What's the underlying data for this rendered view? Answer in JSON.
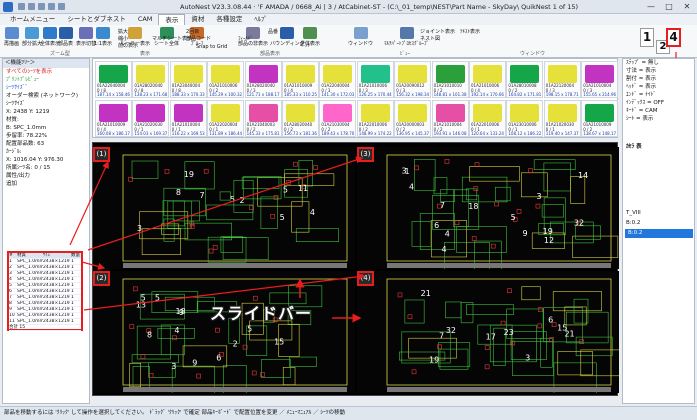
{
  "window": {
    "title": "AutoNest V23.3.08.44 · 'F AMADA / 0668_Ai | 3 / AtCabinet-ST - (C:\\_01_temp\\NEST\\Part Name - SkyDay\\ QuikNest 1 of 15)",
    "buttons": [
      "—",
      "□",
      "✕"
    ]
  },
  "menu": [
    "ホームメニュー",
    "シートとダブネスト",
    "CAM",
    "表示",
    "資材",
    "各種設定",
    "ﾍﾙﾌﾟ"
  ],
  "menu_active": 3,
  "ribbon": {
    "buttons": [
      {
        "label": "再描画",
        "icon": "redraw-icon"
      },
      {
        "label": "部分拡大",
        "icon": "zoom-icon"
      },
      {
        "label": "全体表示",
        "icon": "fit-icon"
      },
      {
        "label": "部品表",
        "icon": "parts-icon"
      },
      {
        "label": "表示切替",
        "icon": "switch-icon"
      },
      {
        "label": "1:1表示",
        "icon": "scale-icon"
      },
      {
        "label": "ルーラー表示",
        "icon": "ruler-icon"
      },
      {
        "label": "シート全体",
        "icon": "sheet-icon"
      },
      {
        "label": "ﾌﾟﾙｰﾌ",
        "icon": "proof-icon"
      },
      {
        "label": "部品の非表示",
        "icon": "hide-icon"
      },
      {
        "label": "バウンディング",
        "icon": "bbox-icon"
      },
      {
        "label": "全体表示",
        "icon": "all-icon"
      },
      {
        "label": "ウィンドウ",
        "icon": "window-icon"
      },
      {
        "label": "ﾏﾙﾁﾊﾟｰﾄﾌﾟﾛｾｽｸﾞﾙｰﾌﾟ",
        "icon": "multipart-icon"
      }
    ],
    "small": [
      "拡大",
      "縮小",
      "前の表示",
      "マルチシート表示",
      "2回目",
      "部品コード",
      "Snap to Grid",
      "ﾌｨｰﾙﾄﾞ",
      "品番",
      "ﾍﾞﾝﾄﾞ",
      "ジョイント表示",
      "ネスト図",
      "ﾃｷｽﾄ表示"
    ],
    "groups": [
      "ズーム型",
      "表示",
      "部品表示",
      "ﾋﾞｭｰ",
      "ウィンドウ"
    ],
    "keys": [
      "1",
      "2",
      "4"
    ]
  },
  "left_panel": {
    "header": "＜機能ﾂﾘｰ＞",
    "items": [
      {
        "text": "すべてのｼｰﾂを表示",
        "color": "red"
      },
      {
        "text": "ﾌﾟﾘﾝﾄﾌﾟﾚﾋﾞｭｰ",
        "color": "green"
      },
      {
        "text": "ｼｰﾂｻｲｽﾞﾞ",
        "color": "blue"
      },
      {
        "text": "オーダー検索 (ネットワーク)",
        "color": ""
      },
      {
        "text": "ｼｰﾂｻｲｽﾞ",
        "color": ""
      },
      {
        "text": "X: 2438    Y: 1219",
        "color": ""
      },
      {
        "text": "材質:",
        "color": ""
      },
      {
        "text": "B: SPC_1.0mm",
        "color": ""
      },
      {
        "text": "歩留率: 78.22%",
        "color": ""
      },
      {
        "text": "配置部品数: 63",
        "color": ""
      },
      {
        "text": "ｶｰｼﾞﾙ:",
        "color": ""
      },
      {
        "text": "X: 1016.04  Y: 976.30",
        "color": ""
      },
      {
        "text": "所属ｼｰﾂ名: 0 / 15",
        "color": ""
      },
      {
        "text": "属性/出力",
        "color": ""
      },
      {
        "text": "追加",
        "color": ""
      }
    ],
    "table_header": [
      "#",
      "材質",
      "ｻｲｽﾞ",
      "数量"
    ],
    "table_rows": [
      [
        "1",
        "SPC_1.0mm",
        "2438×1219",
        "1"
      ],
      [
        "2",
        "SPC_1.0mm",
        "2438×1219",
        "1"
      ],
      [
        "3",
        "SPC_1.0mm",
        "2438×1219",
        "1"
      ],
      [
        "4",
        "SPC_1.0mm",
        "2438×1219",
        "1"
      ],
      [
        "5",
        "SPC_1.0mm",
        "2438×1219",
        "1"
      ],
      [
        "6",
        "SPC_1.0mm",
        "2438×1219",
        "1"
      ],
      [
        "7",
        "SPC_1.0mm",
        "2438×1219",
        "1"
      ],
      [
        "8",
        "SPC_1.0mm",
        "2438×1219",
        "1"
      ],
      [
        "9",
        "SPC_1.0mm",
        "2438×1219",
        "1"
      ],
      [
        "10",
        "SPC_1.0mm",
        "2438×1219",
        "1"
      ],
      [
        "11",
        "SPC_1.0mm",
        "2438×1219",
        "1"
      ]
    ],
    "table_total": "合計  15"
  },
  "thumbs": [
    {
      "name": "01A22040004",
      "qty": "0 / 8",
      "size": "187.14 x 158.46",
      "color": "#16a64a"
    },
    {
      "name": "01A28020040",
      "qty": "0 / 8",
      "size": "138.23 x 171.68",
      "color": "#e6e13a"
    },
    {
      "name": "01A23040004",
      "qty": "0 / 8",
      "size": "188.33 x 170.33",
      "color": "#e6e13a"
    },
    {
      "name": "01A21010006",
      "qty": "0 / 2",
      "size": "145.29 x 100.32",
      "color": "#e6e13a"
    },
    {
      "name": "01A28020040",
      "qty": "0 / 3",
      "size": "121.71 x 188.17",
      "color": "#c233c2"
    },
    {
      "name": "01A21010009",
      "qty": "0 / 4",
      "size": "185.33 x 110.25",
      "color": "#e6e13a"
    },
    {
      "name": "01A22040004",
      "qty": "0 / 3",
      "size": "141.30 x 172.03",
      "color": "#e6e13a"
    },
    {
      "name": "01A21010006",
      "qty": "0 / 3",
      "size": "126.25 x 170.44",
      "color": "#22c08a"
    },
    {
      "name": "01A20090012",
      "qty": "0 / 3",
      "size": "156.32 x 198.34",
      "color": "#e6e13a"
    },
    {
      "name": "01A21010010",
      "qty": "0 / 2",
      "size": "148.81 x 101.38",
      "color": "#2b9f3a"
    },
    {
      "name": "01A21010006",
      "qty": "0 / 4",
      "size": "192.14 x 170.66",
      "color": "#e6e13a"
    },
    {
      "name": "01A28010008",
      "qty": "0 / 2",
      "size": "164.82 x 171.81",
      "color": "#16a64a"
    },
    {
      "name": "01A22120004",
      "qty": "0 / 3",
      "size": "198.15 x 178.71",
      "color": "#e6e13a"
    },
    {
      "name": "01A21010004",
      "qty": "0 / 3",
      "size": "155.65 x 214.96",
      "color": "#c233c2"
    },
    {
      "name": "01A21010009",
      "qty": "0 / 4",
      "size": "160.08 x 186.17",
      "color": "#c233c2"
    },
    {
      "name": "01A21020030",
      "qty": "0 / 1",
      "size": "154.03 x 169.37",
      "color": "#c233c2"
    },
    {
      "name": "01A21010004",
      "qty": "0 / 1",
      "size": "116.22 x 169.53",
      "color": "#c233c2"
    },
    {
      "name": "01A22020004",
      "qty": "0 / 1",
      "size": "131.89 x 186.44",
      "color": "#e6e13a"
    },
    {
      "name": "01A21040003",
      "qty": "0 / 2",
      "size": "145.33 x 175.81",
      "color": "#e64fa6"
    },
    {
      "name": "01A28020040",
      "qty": "0 / 2",
      "size": "156.73 x 181.36",
      "color": "#e6e13a"
    },
    {
      "name": "01A21030004",
      "qty": "0 / 2",
      "size": "189.43 x 178.70",
      "color": "#ff66cc"
    },
    {
      "name": "01A22010006",
      "qty": "0 / 2",
      "size": "148.99 x 174.22",
      "color": "#e6e13a"
    },
    {
      "name": "01A20000003",
      "qty": "0 / 2",
      "size": "136.95 x 145.37",
      "color": "#e6e13a"
    },
    {
      "name": "01A21010004",
      "qty": "0 / 2",
      "size": "193.91 x 146.08",
      "color": "#e64fa6"
    },
    {
      "name": "01A22010006",
      "qty": "0 / 1",
      "size": "120.64 x 133.24",
      "color": "#e6e13a"
    },
    {
      "name": "01A23010006",
      "qty": "0 / 1",
      "size": "108.12 x 186.22",
      "color": "#e6e13a"
    },
    {
      "name": "01A21020030",
      "qty": "0 / 1",
      "size": "119.40 x 147.37",
      "color": "#e6e13a"
    },
    {
      "name": "01A21010009",
      "qty": "0 / 2",
      "size": "138.67 x 148.17",
      "color": "#16a64a"
    }
  ],
  "panels": [
    {
      "id": "(1)",
      "labels": [
        "5",
        "19",
        "2",
        "8",
        "3",
        "5",
        "4",
        "5",
        "11",
        "7"
      ]
    },
    {
      "id": "(3)",
      "labels": [
        "32",
        "4",
        "19",
        "18",
        "5",
        "4",
        "3",
        "14",
        "3",
        "6",
        "9",
        "7",
        "4",
        "1",
        "12"
      ]
    },
    {
      "id": "(2)",
      "labels": [
        "5",
        "3",
        "13",
        "2",
        "4",
        "9",
        "8",
        "6",
        "5",
        "5",
        "18",
        "9",
        "15"
      ]
    },
    {
      "id": "(4)",
      "labels": [
        "32",
        "19",
        "7",
        "3",
        "6",
        "23",
        "21",
        "21",
        "17",
        "15"
      ]
    }
  ],
  "slider_label": "スライドバー",
  "right_panel": {
    "rows": [
      "ｽﾃｯﾌﾟ = 無し",
      "寸法 = 表示",
      "割付 = 表示",
      "ﾍｯﾄﾞ = 表示",
      "ｴﾝﾄﾞ = ﾅｲﾄﾞ",
      "ｲﾝﾃﾞｯｸｽ = OFF",
      "ｷｰﾄﾞ = CAM",
      "ｼｰﾄ = 表示"
    ],
    "section": "ｶｾﾗ 表",
    "list": [
      "T_VIII",
      "B:0.2",
      "B:0.2"
    ],
    "selected": 2
  },
  "status": "部品を移動するには 'ｸﾘｯｸ' して操作を選択してください。 ﾄﾞﾗｯｸﾞ 'ｸﾘｯｸ' で確定  部品ｷｰﾎﾞｰﾄﾞ で配置位置を変更  ／ ﾒﾆｭｰﾏﾆｭｱﾙ ／ ｼｰﾂの移動"
}
